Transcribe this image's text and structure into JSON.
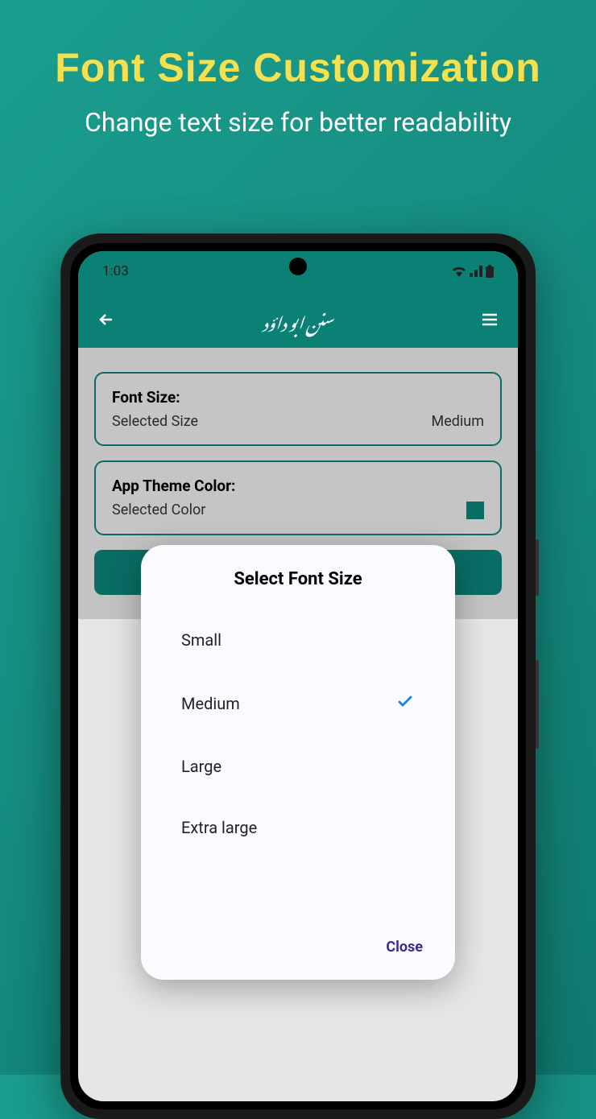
{
  "promo": {
    "title": "Font Size Customization",
    "subtitle": "Change text size for better readability"
  },
  "statusbar": {
    "time": "1:03"
  },
  "appbar": {
    "title": "سنن ابو داؤد"
  },
  "settings": {
    "fontCard": {
      "title": "Font Size:",
      "label": "Selected Size",
      "value": "Medium"
    },
    "themeCard": {
      "title": "App Theme Color:",
      "label": "Selected Color"
    }
  },
  "modal": {
    "title": "Select Font Size",
    "options": [
      "Small",
      "Medium",
      "Large",
      "Extra large"
    ],
    "selectedIndex": 1,
    "closeLabel": "Close"
  }
}
